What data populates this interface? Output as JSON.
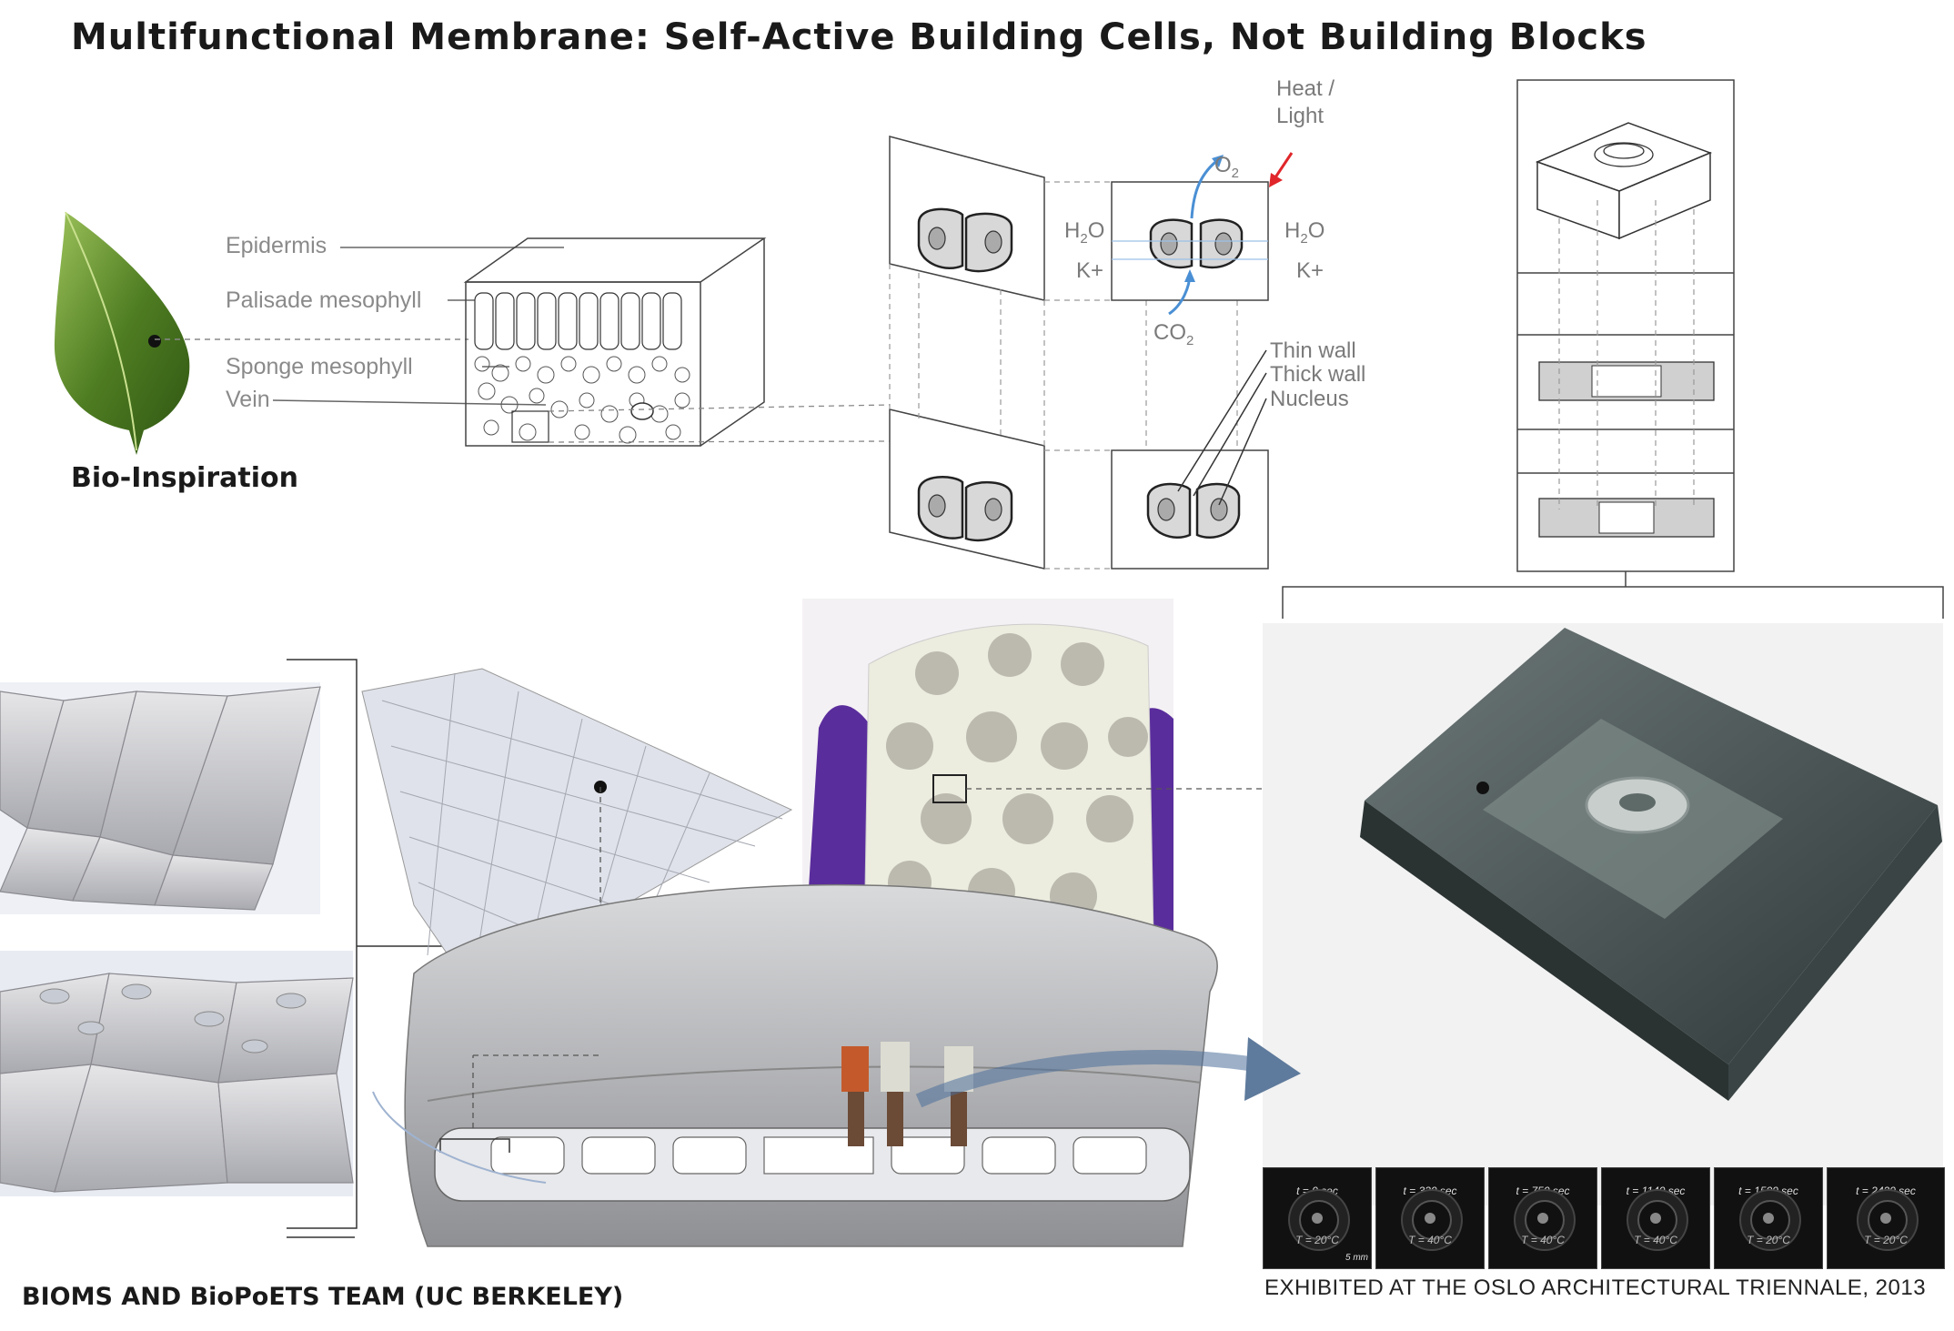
{
  "title": "Multifunctional  Membrane: Self-Active Building Cells, Not Building Blocks",
  "bio_inspiration": "Bio-Inspiration",
  "leaf_labels": {
    "epidermis": "Epidermis",
    "palisade": "Palisade mesophyll",
    "sponge": "Sponge mesophyll",
    "vein": "Vein"
  },
  "stomata_labels": {
    "heat_light_1": "Heat /",
    "heat_light_2": "Light",
    "o2": "O",
    "o2_sub": "2",
    "h2o_left": "H",
    "h2o_left_sub": "2",
    "h2o_left_o": "O",
    "h2o_right": "H",
    "h2o_right_sub": "2",
    "h2o_right_o": "O",
    "k_left": "K+",
    "k_right": "K+",
    "co2": "CO",
    "co2_sub": "2",
    "thin_wall": "Thin wall",
    "thick_wall": "Thick wall",
    "nucleus": "Nucleus"
  },
  "frames": [
    {
      "time": "t = 0 sec",
      "temp": "T = 20°C"
    },
    {
      "time": "t = 330 sec",
      "temp": "T = 40°C"
    },
    {
      "time": "t = 750 sec",
      "temp": "T = 40°C"
    },
    {
      "time": "t = 1140 sec",
      "temp": "T = 40°C"
    },
    {
      "time": "t = 1500 sec",
      "temp": "T = 20°C"
    },
    {
      "time": "t = 2420 sec",
      "temp": "T = 20°C"
    }
  ],
  "scale_bar": "5 mm",
  "team": "BIOMS AND BioPoETS TEAM (UC BERKELEY)",
  "exhibited": "EXHIBITED AT THE OSLO  ARCHITECTURAL TRIENNALE, 2013",
  "colors": {
    "leaf": "#5e8a2c",
    "glove": "#5a2d9c",
    "arrow_red": "#e0262a",
    "arrow_blue": "#4a8fd4",
    "gel": "#3f4a4a"
  }
}
